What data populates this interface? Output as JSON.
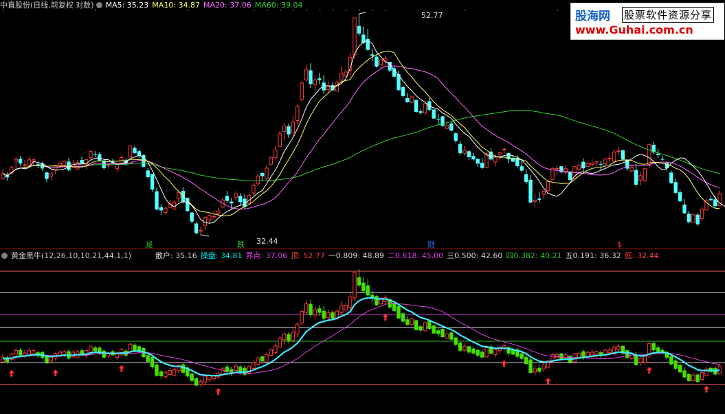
{
  "main_header": {
    "security": "中直股份(日线,前复权 对数)",
    "ma5_label": "MA5: 35.23",
    "ma10_label": "MA10: 34.87",
    "ma20_label": "MA20: 37.06",
    "ma60_label": "MA60: 39.04"
  },
  "sub_header": {
    "indicator": "黄金黑牛(12,26,10,10,21,44,1,1)",
    "items": [
      {
        "text": "散户: 35.16",
        "color": "#d8d8d8"
      },
      {
        "text": "操盘: 34.81",
        "color": "#00e8e8"
      },
      {
        "text": "界点: 37.06",
        "color": "#e040e0"
      },
      {
        "text": "顶: 52.77",
        "color": "#ff4040"
      },
      {
        "text": "一0.809: 48.89",
        "color": "#d8d8d8"
      },
      {
        "text": "二0.618: 45.00",
        "color": "#e040e0"
      },
      {
        "text": "三0.500: 42.60",
        "color": "#d8d8d8"
      },
      {
        "text": "四0.382: 40.21",
        "color": "#30c030"
      },
      {
        "text": "五0.191: 36.32",
        "color": "#d8d8d8"
      },
      {
        "text": "低: 32.44",
        "color": "#ff4040"
      }
    ]
  },
  "logo": {
    "name": "股海网",
    "slogan": "股票软件资源分享",
    "url": "www.Guhai.com.cn"
  },
  "markers": [
    {
      "text": "减",
      "color": "#30c030"
    },
    {
      "text": "跌",
      "color": "#30c030"
    },
    {
      "text": "财",
      "color": "#3070ff"
    },
    {
      "text": "$",
      "color": "#ff3030"
    }
  ],
  "annotations": {
    "high": "52.77",
    "low": "32.44"
  },
  "colors": {
    "up": "#ff3c3c",
    "down": "#54ffff",
    "sub_up": "#ff3c3c",
    "sub_down": "#44e000",
    "ma5": "#ffffff",
    "ma10": "#ffff66",
    "ma20": "#ff66ff",
    "ma60": "#30d030"
  },
  "chart_data": {
    "type": "candlestick",
    "y_scale": "log",
    "ylim": [
      32.44,
      52.77
    ],
    "ohlc": [
      [
        36.72,
        37.49,
        36.64,
        37.11
      ],
      [
        37.02,
        37.22,
        36.54,
        36.81
      ],
      [
        37.17,
        37.75,
        37.05,
        37.66
      ],
      [
        38.14,
        38.5,
        37.45,
        38.3
      ],
      [
        38.35,
        38.58,
        37.74,
        37.95
      ],
      [
        37.84,
        38.21,
        37.51,
        37.85
      ],
      [
        37.83,
        38.56,
        37.72,
        38.26
      ],
      [
        38.14,
        38.37,
        37.73,
        38.26
      ],
      [
        37.89,
        38.12,
        37.57,
        37.85
      ],
      [
        37.95,
        38.08,
        37.33,
        37.54
      ],
      [
        37.21,
        37.28,
        36.41,
        36.68
      ],
      [
        36.91,
        37.24,
        36.59,
        37.1
      ],
      [
        37.4,
        37.84,
        37.1,
        37.77
      ],
      [
        37.76,
        38.19,
        37.65,
        37.99
      ],
      [
        37.81,
        38.21,
        37.72,
        38.15
      ],
      [
        38.11,
        38.4,
        37.3,
        37.41
      ],
      [
        37.65,
        38.27,
        37.61,
        37.99
      ],
      [
        37.49,
        38.26,
        37.48,
        38.04
      ],
      [
        38.25,
        38.54,
        37.89,
        37.94
      ],
      [
        37.86,
        38.34,
        37.48,
        38.29
      ],
      [
        38.46,
        39.05,
        38.31,
        38.99
      ],
      [
        38.75,
        39.0,
        38.5,
        38.71
      ],
      [
        38.74,
        38.91,
        38.18,
        38.2
      ],
      [
        38.2,
        38.27,
        37.46,
        37.57
      ],
      [
        37.8,
        37.97,
        37.54,
        37.86
      ],
      [
        38.1,
        38.33,
        37.94,
        37.99
      ],
      [
        37.52,
        38.02,
        37.26,
        37.89
      ],
      [
        37.98,
        38.58,
        37.93,
        38.45
      ],
      [
        38.2,
        38.39,
        37.75,
        37.95
      ],
      [
        38.49,
        39.49,
        38.43,
        39.44
      ],
      [
        39.28,
        39.45,
        38.74,
        38.84
      ],
      [
        38.99,
        39.13,
        38.4,
        38.56
      ],
      [
        38.68,
        38.71,
        37.63,
        37.68
      ],
      [
        37.37,
        37.57,
        36.73,
        36.83
      ],
      [
        37.09,
        37.1,
        35.68,
        35.84
      ],
      [
        35.7,
        35.98,
        34.21,
        34.3
      ],
      [
        34.46,
        34.7,
        33.9,
        34.23
      ],
      [
        34.07,
        34.51,
        33.89,
        34.4
      ],
      [
        34.47,
        35.04,
        34.37,
        34.73
      ],
      [
        34.32,
        35.06,
        34.3,
        34.85
      ],
      [
        35.16,
        35.76,
        34.89,
        35.61
      ],
      [
        35.74,
        36.02,
        34.75,
        34.86
      ],
      [
        35.18,
        35.22,
        34.1,
        34.19
      ],
      [
        34.07,
        34.1,
        33.28,
        33.4
      ],
      [
        33.26,
        33.38,
        32.47,
        32.55
      ],
      [
        32.7,
        33.04,
        32.44,
        32.77
      ],
      [
        33.13,
        33.79,
        32.76,
        33.71
      ],
      [
        33.53,
        33.9,
        33.3,
        33.85
      ],
      [
        33.76,
        34.18,
        33.48,
        33.79
      ],
      [
        34.03,
        34.42,
        33.78,
        34.18
      ],
      [
        34.48,
        35.25,
        34.4,
        35.03
      ],
      [
        35.34,
        35.73,
        34.81,
        34.96
      ],
      [
        34.9,
        35.19,
        34.36,
        34.76
      ],
      [
        35.21,
        35.71,
        35.04,
        35.5
      ],
      [
        35.34,
        35.54,
        34.58,
        34.86
      ],
      [
        35.12,
        35.48,
        34.33,
        34.5
      ],
      [
        34.77,
        35.53,
        34.76,
        35.37
      ],
      [
        35.57,
        36.34,
        35.4,
        36.16
      ],
      [
        36.29,
        37.11,
        36.13,
        36.92
      ],
      [
        37.17,
        37.22,
        36.59,
        36.91
      ],
      [
        36.7,
        37.83,
        36.58,
        37.57
      ],
      [
        37.89,
        38.55,
        37.83,
        38.47
      ],
      [
        38.44,
        39.47,
        38.32,
        39.11
      ],
      [
        39.41,
        40.76,
        39.35,
        40.56
      ],
      [
        40.72,
        41.47,
        39.98,
        41.21
      ],
      [
        41.2,
        41.45,
        40.15,
        40.46
      ],
      [
        40.62,
        42.15,
        40.16,
        41.58
      ],
      [
        41.72,
        43.25,
        41.32,
        43.03
      ],
      [
        43.71,
        45.53,
        43.49,
        45.3
      ],
      [
        45.62,
        47.17,
        45.4,
        46.7
      ],
      [
        46.59,
        47.31,
        44.83,
        45.2
      ],
      [
        45.13,
        46.08,
        44.55,
        45.62
      ],
      [
        45.77,
        46.32,
        45.18,
        45.61
      ],
      [
        45.35,
        46.11,
        44.23,
        44.58
      ],
      [
        44.65,
        45.47,
        44.46,
        45.05
      ],
      [
        45.1,
        45.4,
        44.55,
        44.58
      ],
      [
        44.52,
        45.55,
        44.39,
        45.36
      ],
      [
        45.6,
        46.98,
        45.21,
        46.3
      ],
      [
        46.04,
        46.62,
        45.92,
        46.41
      ],
      [
        46.56,
        48.4,
        46.04,
        47.92
      ],
      [
        48.22,
        52.3,
        47.77,
        52.29
      ],
      [
        51.38,
        52.77,
        50.25,
        50.52
      ],
      [
        50.4,
        51.32,
        49.37,
        49.49
      ],
      [
        49.91,
        51.06,
        48.63,
        48.74
      ],
      [
        48.25,
        48.89,
        47.55,
        48.11
      ],
      [
        48.01,
        48.13,
        46.87,
        46.97
      ],
      [
        47.15,
        47.77,
        46.76,
        47.67
      ],
      [
        47.54,
        48.15,
        47.12,
        47.82
      ],
      [
        47.47,
        47.48,
        46.41,
        46.57
      ],
      [
        46.79,
        46.96,
        45.85,
        45.94
      ],
      [
        46.2,
        46.56,
        44.54,
        44.6
      ],
      [
        44.9,
        45.04,
        43.82,
        44.03
      ],
      [
        43.82,
        44.35,
        43.4,
        43.42
      ],
      [
        43.43,
        44.1,
        43.33,
        43.95
      ],
      [
        43.66,
        43.66,
        42.45,
        42.51
      ],
      [
        42.57,
        42.81,
        42.28,
        42.42
      ],
      [
        42.4,
        43.39,
        42.24,
        43.28
      ],
      [
        43.53,
        43.82,
        42.57,
        42.71
      ],
      [
        42.74,
        42.76,
        41.88,
        41.9
      ],
      [
        41.84,
        42.32,
        41.37,
        41.82
      ],
      [
        42.11,
        42.14,
        41.13,
        41.24
      ],
      [
        40.99,
        41.67,
        40.95,
        41.25
      ],
      [
        41.45,
        41.58,
        40.73,
        40.8
      ],
      [
        40.56,
        40.67,
        39.72,
        39.9
      ],
      [
        39.63,
        39.89,
        38.64,
        38.82
      ],
      [
        38.82,
        39.49,
        38.63,
        39.07
      ],
      [
        38.99,
        39.09,
        38.21,
        38.49
      ],
      [
        38.58,
        38.86,
        38.21,
        38.3
      ],
      [
        38.34,
        38.4,
        37.68,
        37.94
      ],
      [
        38.02,
        38.4,
        37.52,
        37.58
      ],
      [
        37.64,
        38.91,
        37.55,
        38.79
      ],
      [
        38.96,
        39.23,
        38.14,
        38.29
      ],
      [
        38.07,
        38.75,
        37.71,
        38.49
      ],
      [
        38.74,
        38.91,
        38.28,
        38.87
      ],
      [
        39.17,
        39.38,
        38.77,
        39.17
      ],
      [
        38.84,
        38.85,
        37.98,
        38.3
      ],
      [
        38.41,
        38.6,
        38.08,
        38.11
      ],
      [
        38.42,
        38.62,
        37.61,
        37.73
      ],
      [
        37.72,
        38.17,
        37.24,
        37.36
      ],
      [
        37.07,
        37.48,
        36.26,
        36.44
      ],
      [
        36.62,
        37.0,
        34.77,
        34.83
      ],
      [
        34.92,
        35.5,
        34.44,
        35.0
      ],
      [
        35.13,
        35.64,
        34.81,
        35.04
      ],
      [
        35.46,
        35.84,
        35.07,
        35.7
      ],
      [
        35.78,
        36.58,
        35.64,
        36.46
      ],
      [
        36.65,
        37.66,
        36.57,
        37.55
      ],
      [
        37.51,
        37.76,
        36.99,
        37.55
      ],
      [
        37.72,
        37.74,
        37.13,
        37.23
      ],
      [
        37.18,
        37.76,
        37.05,
        37.52
      ],
      [
        37.29,
        37.3,
        36.54,
        36.61
      ],
      [
        36.72,
        37.76,
        36.7,
        37.69
      ],
      [
        37.48,
        38.05,
        37.39,
        37.8
      ],
      [
        38.1,
        38.4,
        37.28,
        37.55
      ],
      [
        37.71,
        38.09,
        37.68,
        37.97
      ],
      [
        37.87,
        38.35,
        37.67,
        37.99
      ],
      [
        38.01,
        38.17,
        37.71,
        38.11
      ],
      [
        37.91,
        38.19,
        37.43,
        37.86
      ],
      [
        37.93,
        38.4,
        37.6,
        38.35
      ],
      [
        38.38,
        38.74,
        38.06,
        38.4
      ],
      [
        38.15,
        39.14,
        37.94,
        38.93
      ],
      [
        38.97,
        39.36,
        38.69,
        39.01
      ],
      [
        39.07,
        39.16,
        38.17,
        38.29
      ],
      [
        38.28,
        38.29,
        37.33,
        37.53
      ],
      [
        37.33,
        37.89,
        37.2,
        37.65
      ],
      [
        37.41,
        37.9,
        36.07,
        36.22
      ],
      [
        36.6,
        37.24,
        36.16,
        36.95
      ],
      [
        36.58,
        37.53,
        36.39,
        37.52
      ],
      [
        37.8,
        39.69,
        37.6,
        39.56
      ],
      [
        39.55,
        39.81,
        38.72,
        38.89
      ],
      [
        38.78,
        39.21,
        38.42,
        38.67
      ],
      [
        38.34,
        38.59,
        38.18,
        38.27
      ],
      [
        38.0,
        38.1,
        37.33,
        37.56
      ],
      [
        37.2,
        37.37,
        36.27,
        36.35
      ],
      [
        36.43,
        36.71,
        35.47,
        35.58
      ],
      [
        35.62,
        35.82,
        34.84,
        34.92
      ],
      [
        34.67,
        35.11,
        33.94,
        34.02
      ],
      [
        33.98,
        34.2,
        33.27,
        33.36
      ],
      [
        33.35,
        34.03,
        33.33,
        33.9
      ],
      [
        33.91,
        34.02,
        33.1,
        33.2
      ],
      [
        33.61,
        34.55,
        33.44,
        34.33
      ],
      [
        34.27,
        35.15,
        34.22,
        34.99
      ],
      [
        35.11,
        35.35,
        34.89,
        35.01
      ],
      [
        35.07,
        35.36,
        34.43,
        34.55
      ],
      [
        34.6,
        35.74,
        34.58,
        35.51
      ]
    ],
    "ma5": [
      37.11,
      36.96,
      37.19,
      37.47,
      37.57,
      37.51,
      37.6,
      38.12,
      38.03,
      37.95,
      37.72,
      37.5,
      37.41,
      37.42,
      37.5,
      37.68,
      37.86,
      37.92,
      37.91,
      37.94,
      38.25,
      38.39,
      38.43,
      38.29,
      38.27,
      38.07,
      37.9,
      37.95,
      38.03,
      38.35,
      38.51,
      38.65,
      38.49,
      38.07,
      37.38,
      36.64,
      35.86,
      35.12,
      34.7,
      34.51,
      34.76,
      34.89,
      34.85,
      34.6,
      34.12,
      33.55,
      33.32,
      33.28,
      33.33,
      33.66,
      33.91,
      34.16,
      34.3,
      34.49,
      34.62,
      34.74,
      34.99,
      35.27,
      35.56,
      35.76,
      36.3,
      36.87,
      37.4,
      38.13,
      38.98,
      39.56,
      40.18,
      40.97,
      41.86,
      42.95,
      43.7,
      44.17,
      44.69,
      45.06,
      45.01,
      44.97,
      45.0,
      45.26,
      45.73,
      46.81,
      48.35,
      49.12,
      49.58,
      49.74,
      49.43,
      48.51,
      47.98,
      47.49,
      47.21,
      46.64,
      46.14,
      45.51,
      44.97,
      44.55,
      44.06,
      43.71,
      43.44,
      43.07,
      42.9,
      42.77,
      42.42,
      42.19,
      41.9,
      41.39,
      40.96,
      40.56,
      40.29,
      39.8,
      39.34,
      38.99,
      38.67,
      38.53,
      38.52,
      38.53,
      38.6,
      38.7,
      38.6,
      38.49,
      38.24,
      37.85,
      37.42,
      36.99,
      36.49,
      35.95,
      35.54,
      35.41,
      35.3,
      35.53,
      35.96,
      36.39,
      36.9,
      37.19,
      37.26,
      37.18,
      37.12,
      37.23,
      37.39,
      37.53,
      37.72,
      37.84,
      37.88,
      38.02,
      38.13,
      38.34,
      38.58,
      38.74,
      38.62,
      38.43,
      38.13,
      37.68,
      37.42,
      37.53,
      37.99,
      38.23,
      38.42,
      38.4,
      38.05,
      37.72,
      37.35,
      36.88,
      36.32,
      35.72,
      35.18,
      34.79,
      34.58,
      34.43,
      34.25,
      34.31,
      34.48,
      34.67
    ]
  }
}
